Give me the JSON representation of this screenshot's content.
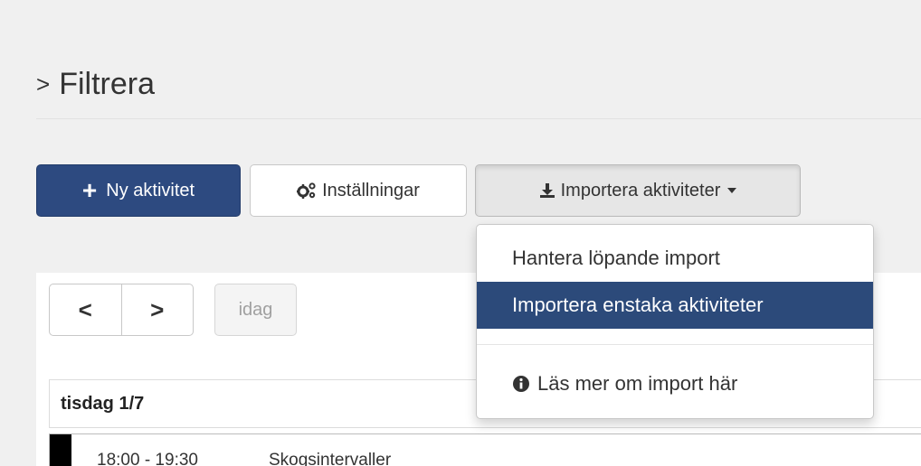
{
  "header": {
    "chevron": ">",
    "title": "Filtrera"
  },
  "toolbar": {
    "new_activity_label": "Ny aktivitet",
    "settings_label": "Inställningar",
    "import_label": "Importera aktiviteter",
    "primary_color": "#2d4a80"
  },
  "calendar_nav": {
    "prev_label": "<",
    "next_label": ">",
    "today_label": "idag"
  },
  "day": {
    "label": "tisdag 1/7"
  },
  "event": {
    "time": "18:00 - 19:30",
    "title": "Skogsintervaller",
    "color": "#000000"
  },
  "dropdown": {
    "items": [
      {
        "label": "Hantera löpande import",
        "active": false
      },
      {
        "label": "Importera enstaka aktiviteter",
        "active": true
      }
    ],
    "help_item": {
      "icon": "info-circle-icon",
      "label": "Läs mer om import här"
    },
    "active_color": "#2c4a7a"
  }
}
